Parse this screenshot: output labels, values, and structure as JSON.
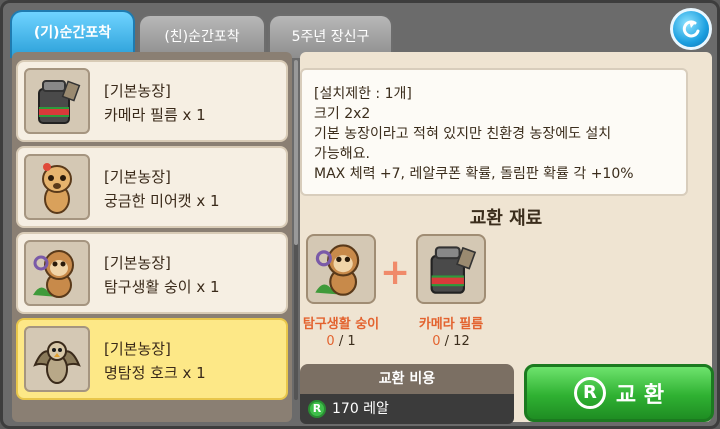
{
  "tabs": [
    {
      "label": "(기)순간포착",
      "active": true
    },
    {
      "label": "(친)순간포착",
      "active": false
    },
    {
      "label": "5주년 장신구",
      "active": false
    }
  ],
  "items": [
    {
      "category": "[기본농장]",
      "name": "카메라 필름 x 1",
      "icon": "camera-film-icon"
    },
    {
      "category": "[기본농장]",
      "name": "궁금한 미어캣 x 1",
      "icon": "meerkat-icon"
    },
    {
      "category": "[기본농장]",
      "name": "탐구생활 숭이 x 1",
      "icon": "monkey-icon"
    },
    {
      "category": "[기본농장]",
      "name": "명탐정 호크 x 1",
      "icon": "hawk-icon",
      "selected": true
    }
  ],
  "description": {
    "lines": [
      "[설치제한 : 1개]",
      "크기 2x2",
      "기본 농장이라고 적혀 있지만 친환경 농장에도 설치",
      "가능해요.",
      "MAX 체력 +7, 레알쿠폰 확률, 돌림판 확률 각 +10%"
    ]
  },
  "materials": {
    "title": "교환 재료",
    "list": [
      {
        "name": "탐구생활 숭이",
        "have": "0",
        "need": "/ 1",
        "icon": "monkey-icon"
      },
      {
        "name": "카메라 필름",
        "have": "0",
        "need": "/ 12",
        "icon": "camera-film-icon"
      }
    ]
  },
  "cost": {
    "label": "교환 비용",
    "currency_symbol": "R",
    "value": "170 레알"
  },
  "exchange_button": {
    "symbol": "R",
    "label": "교 환"
  },
  "colors": {
    "active_tab": "#2a9fd8",
    "selected_item": "#fde887",
    "exchange_button": "#2fb132",
    "material_name": "#e3632f"
  }
}
